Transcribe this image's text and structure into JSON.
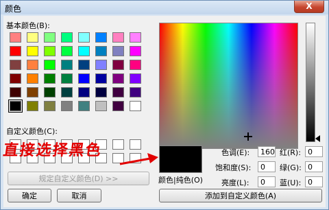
{
  "window": {
    "title": "颜色",
    "close_label": "X"
  },
  "basic_colors_label": "基本颜色(B):",
  "basic_colors": [
    "#ff8080",
    "#ffff80",
    "#80ff80",
    "#00ff80",
    "#80ffff",
    "#0080ff",
    "#ff80c0",
    "#ff80ff",
    "#ff0000",
    "#ffff00",
    "#80ff00",
    "#00ff40",
    "#00ffff",
    "#0080c0",
    "#8080c0",
    "#ff00ff",
    "#804040",
    "#ff8040",
    "#00ff00",
    "#008080",
    "#004080",
    "#8080ff",
    "#800040",
    "#ff0080",
    "#800000",
    "#ff8000",
    "#008000",
    "#008040",
    "#0000ff",
    "#0000a0",
    "#800080",
    "#8000ff",
    "#400000",
    "#804000",
    "#004000",
    "#004040",
    "#000080",
    "#000040",
    "#400040",
    "#400080",
    "#000000",
    "#808000",
    "#808040",
    "#808080",
    "#408080",
    "#c0c0c0",
    "#400040",
    "#ffffff"
  ],
  "selected_basic_index": 40,
  "custom_colors_label": "自定义颜色(C):",
  "annotation_text": "直接选择黑色",
  "define_custom_button": "规定自定义颜色(D) >>",
  "ok_button": "确定",
  "cancel_button": "取消",
  "color_solid_label": "颜色|纯色(O)",
  "fields": {
    "hue": {
      "label": "色调(E):",
      "value": "160"
    },
    "sat": {
      "label": "饱和度(S):",
      "value": "0"
    },
    "lum": {
      "label": "亮度(L):",
      "value": "0"
    },
    "red": {
      "label": "红(R):",
      "value": "0"
    },
    "green": {
      "label": "绿(G):",
      "value": "0"
    },
    "blue": {
      "label": "蓝(U):",
      "value": "0"
    }
  },
  "add_custom_button": "添加到自定义颜色(A)",
  "colors": {
    "annotation": "#e20000",
    "preview": "#000000"
  }
}
